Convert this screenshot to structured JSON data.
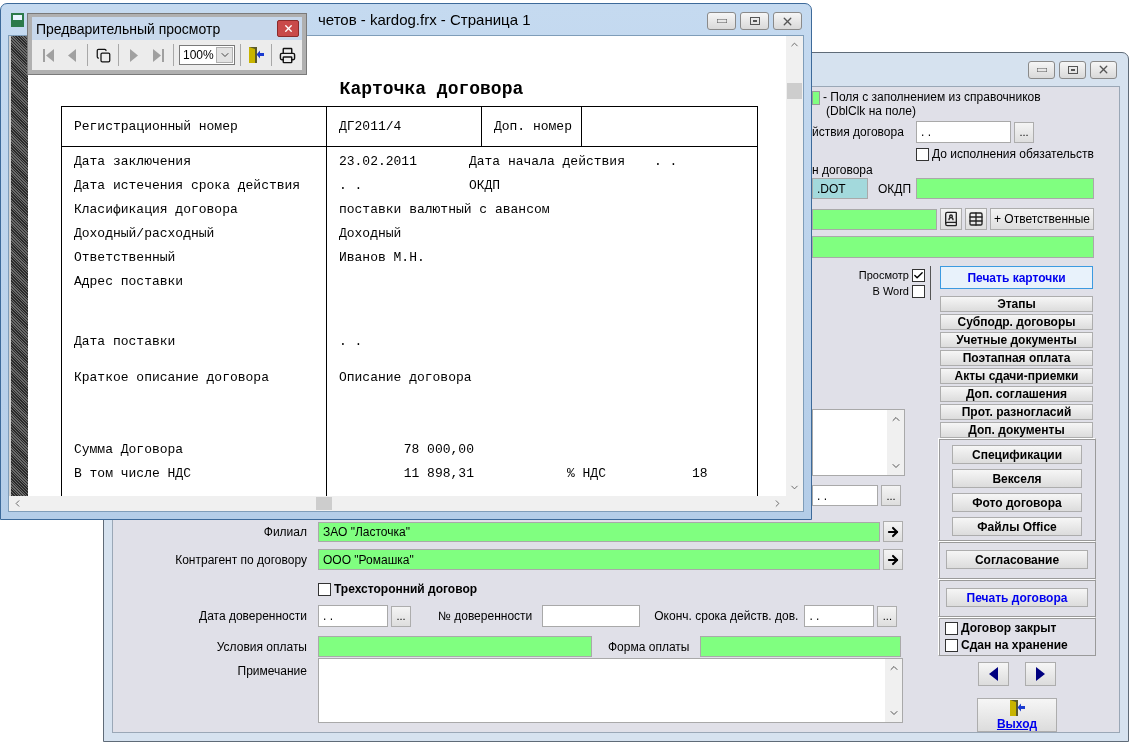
{
  "preview_window": {
    "title": "четов - kardog.frx - Страница 1",
    "report": {
      "title": "Карточка договора",
      "header": [
        "Регистрационный номер",
        "ДГ2011/4",
        "Доп. номер"
      ],
      "rows": [
        {
          "kind": "single",
          "label": "Дата заключения",
          "value": "23.02.2011",
          "label2": "Дата начала действия",
          "value2": ". ."
        },
        {
          "kind": "single",
          "label": "Дата истечения срока действия",
          "value": ". .",
          "label2": "ОКДП"
        },
        {
          "kind": "single",
          "label": "Класификация договора",
          "value": "поставки валютный с авансом"
        },
        {
          "kind": "single",
          "label": "Доходный/расходный",
          "value": "Доходный"
        },
        {
          "kind": "single",
          "label": "Ответственный",
          "value": "Иванов М.Н."
        },
        {
          "kind": "double",
          "label": "Адрес поставки"
        },
        {
          "kind": "spaced",
          "label": "Дата поставки",
          "value": ". ."
        },
        {
          "kind": "triple",
          "label": "Краткое описание договора",
          "value": "Описание договора"
        },
        {
          "kind": "amount",
          "label": "Сумма Договора",
          "value": "78 000,00"
        },
        {
          "kind": "amount",
          "label": "В том числе НДС",
          "value": "11 898,31",
          "label2": "% НДС",
          "value2": "18"
        }
      ]
    }
  },
  "preview_toolbar": {
    "title": "Предварительный просмотр",
    "tools": [
      {
        "kind": "first",
        "disabled": true
      },
      {
        "kind": "prev",
        "disabled": true
      },
      {
        "kind": "pages",
        "disabled": false
      },
      {
        "kind": "next",
        "disabled": true
      },
      {
        "kind": "last",
        "disabled": true
      },
      {
        "kind": "zoom",
        "value": "100%"
      },
      {
        "kind": "exit",
        "disabled": false
      },
      {
        "kind": "print",
        "disabled": false
      }
    ]
  },
  "contract_window": {
    "legend": {
      "color": "#80ff80",
      "text": "- Поля с заполнением из справочников",
      "note": "(DblClk на поле)"
    },
    "end_date": {
      "label": "йствия договора",
      "value": ". .",
      "button": "..."
    },
    "until_fulfilled": {
      "label": "До исполнения обязательств",
      "checked": false
    },
    "template": {
      "label": "н договора",
      "value": ".DOT",
      "kind": "template"
    },
    "okdp": {
      "label": "ОКДП",
      "kind": "lookup"
    },
    "field_6": {
      "kind": "lookup"
    },
    "add_button": "+ Ответственные",
    "field_7": {
      "kind": "lookup"
    },
    "print_options": [
      {
        "label": "Просмотр",
        "checked": true
      },
      {
        "label": "В Word",
        "checked": false
      }
    ],
    "print_card_button": "Печать карточки",
    "section_buttons": [
      "Этапы",
      "Субподр. договоры",
      "Учетные документы",
      "Поэтапная оплата",
      "Акты сдачи-приемки",
      "Доп. соглашения",
      "Прот. разногласий",
      "Доп. документы"
    ],
    "attachment_buttons": [
      "Спецификации",
      "Векселя",
      "Фото договора",
      "Файлы Office"
    ],
    "approval_button": "Согласование",
    "print_contract_button": "Печать договора",
    "flags": [
      {
        "label": "Договор закрыт",
        "checked": false
      },
      {
        "label": "Сдан на хранение",
        "checked": false
      }
    ],
    "exit_button": "Выход",
    "form": {
      "date_field": {
        "value": ". .",
        "button": "..."
      },
      "branch": {
        "label": "Филиал",
        "value": "ЗАО \"Ласточка\"",
        "kind": "lookup"
      },
      "counterparty": {
        "label": "Контрагент по договору",
        "value": "ООО \"Ромашка\"",
        "kind": "lookup"
      },
      "tripartite": {
        "label": "Трехсторонний договор",
        "checked": false
      },
      "poa_date": {
        "label": "Дата доверенности",
        "value": ". .",
        "button": "..."
      },
      "poa_number": {
        "label": "№ доверенности"
      },
      "poa_expiry": {
        "label": "Оконч. срока действ. дов.",
        "value": ". .",
        "button": "..."
      },
      "payment_terms": {
        "label": "Условия оплаты",
        "kind": "lookup"
      },
      "payment_form": {
        "label": "Форма оплаты",
        "kind": "lookup"
      },
      "note": {
        "label": "Примечание"
      }
    }
  }
}
